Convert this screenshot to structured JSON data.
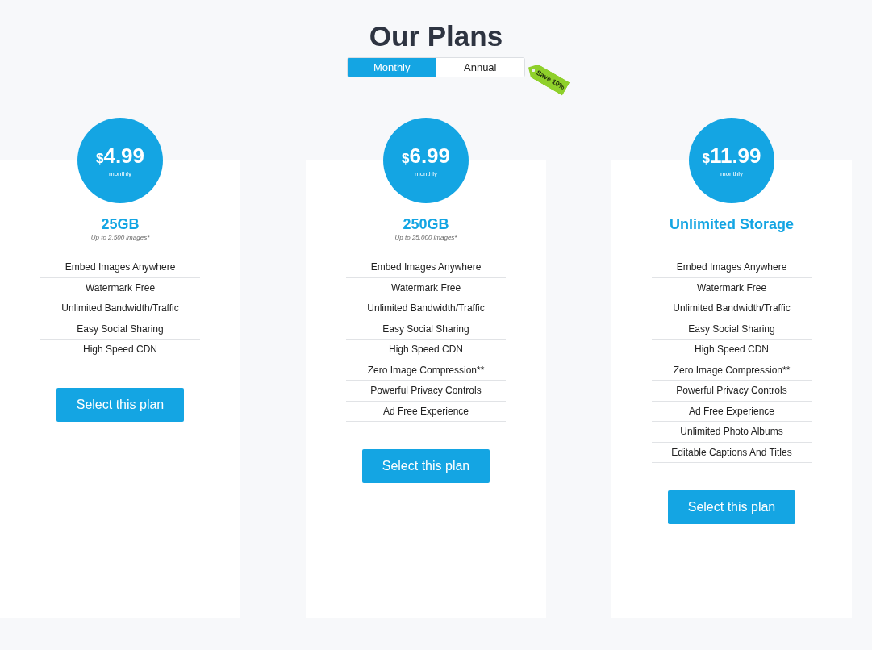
{
  "title": "Our Plans",
  "billing_toggle": {
    "options": [
      {
        "label": "Monthly",
        "selected": true
      },
      {
        "label": "Annual",
        "selected": false
      }
    ],
    "tag": "Save 10%"
  },
  "plans": [
    {
      "currency": "$",
      "amount": "4.99",
      "period": "monthly",
      "name": "25GB",
      "note": "Up to 2,500 images*",
      "features": [
        "Embed Images Anywhere",
        "Watermark Free",
        "Unlimited Bandwidth/Traffic",
        "Easy Social Sharing",
        "High Speed CDN"
      ],
      "button": "Select this plan"
    },
    {
      "currency": "$",
      "amount": "6.99",
      "period": "monthly",
      "name": "250GB",
      "note": "Up to 25,000 images*",
      "features": [
        "Embed Images Anywhere",
        "Watermark Free",
        "Unlimited Bandwidth/Traffic",
        "Easy Social Sharing",
        "High Speed CDN",
        "Zero Image Compression**",
        "Powerful Privacy Controls",
        "Ad Free Experience"
      ],
      "button": "Select this plan"
    },
    {
      "currency": "$",
      "amount": "11.99",
      "period": "monthly",
      "name": "Unlimited Storage",
      "features": [
        "Embed Images Anywhere",
        "Watermark Free",
        "Unlimited Bandwidth/Traffic",
        "Easy Social Sharing",
        "High Speed CDN",
        "Zero Image Compression**",
        "Powerful Privacy Controls",
        "Ad Free Experience",
        "Unlimited Photo Albums",
        "Editable Captions And Titles"
      ],
      "button": "Select this plan"
    }
  ]
}
